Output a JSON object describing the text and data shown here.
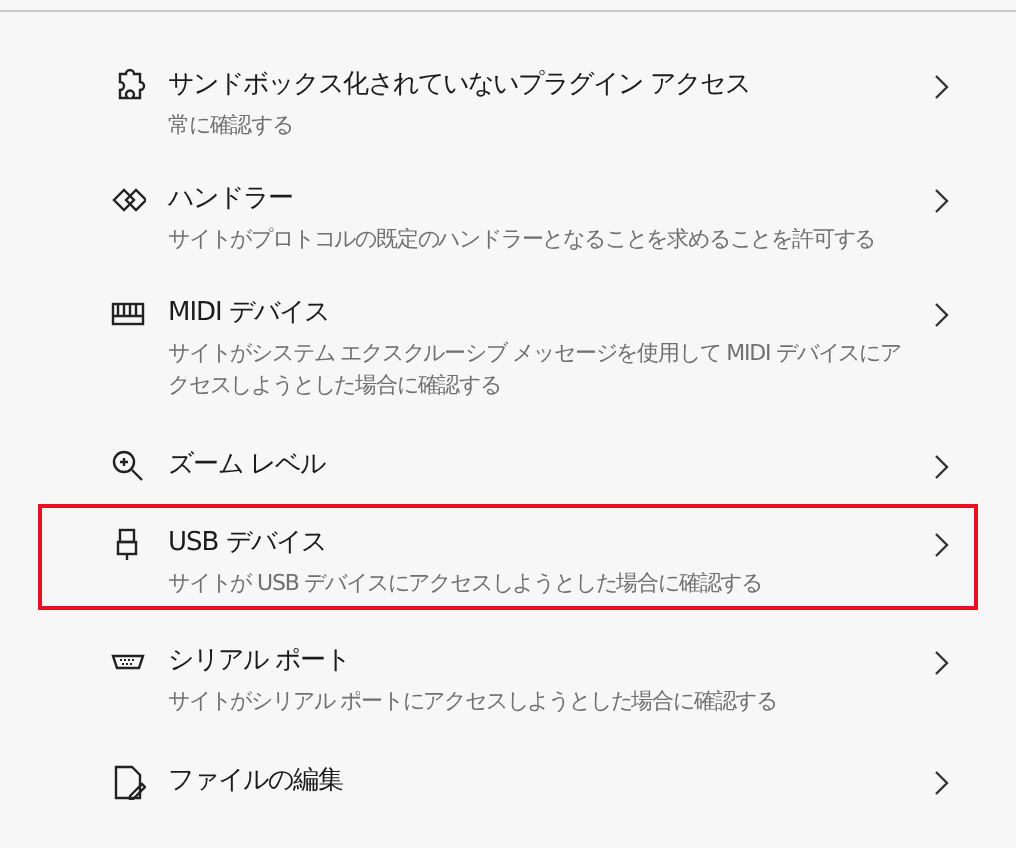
{
  "items": [
    {
      "title": "サンドボックス化されていないプラグイン アクセス",
      "description": "常に確認する",
      "highlighted": false
    },
    {
      "title": "ハンドラー",
      "description": "サイトがプロトコルの既定のハンドラーとなることを求めることを許可する",
      "highlighted": false
    },
    {
      "title": "MIDI デバイス",
      "description": "サイトがシステム エクスクルーシブ メッセージを使用して MIDI デバイスにアクセスしようとした場合に確認する",
      "highlighted": false
    },
    {
      "title": "ズーム レベル",
      "highlighted": false
    },
    {
      "title": "USB デバイス",
      "description": "サイトが USB デバイスにアクセスしようとした場合に確認する",
      "highlighted": true
    },
    {
      "title": "シリアル ポート",
      "description": "サイトがシリアル ポートにアクセスしようとした場合に確認する",
      "highlighted": false
    },
    {
      "title": "ファイルの編集",
      "highlighted": false
    }
  ]
}
